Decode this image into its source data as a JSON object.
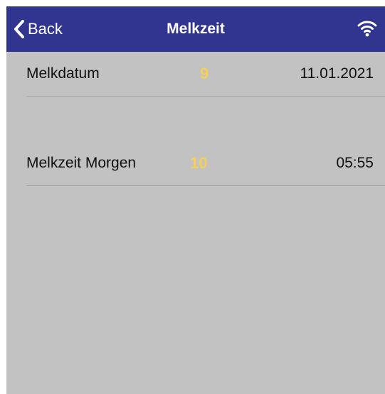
{
  "colors": {
    "navbar_bg": "#31358f",
    "screen_bg": "#c2c2c2",
    "badge": "#f6cf57",
    "text": "#111111"
  },
  "navbar": {
    "back_label": "Back",
    "back_icon": "chevron-left-icon",
    "title": "Melkzeit",
    "status_icon": "wifi-icon"
  },
  "rows": [
    {
      "label": "Melkdatum",
      "badge": "9",
      "value": "11.01.2021"
    },
    {
      "label": "Melkzeit Morgen",
      "badge": "10",
      "value": "05:55"
    }
  ]
}
